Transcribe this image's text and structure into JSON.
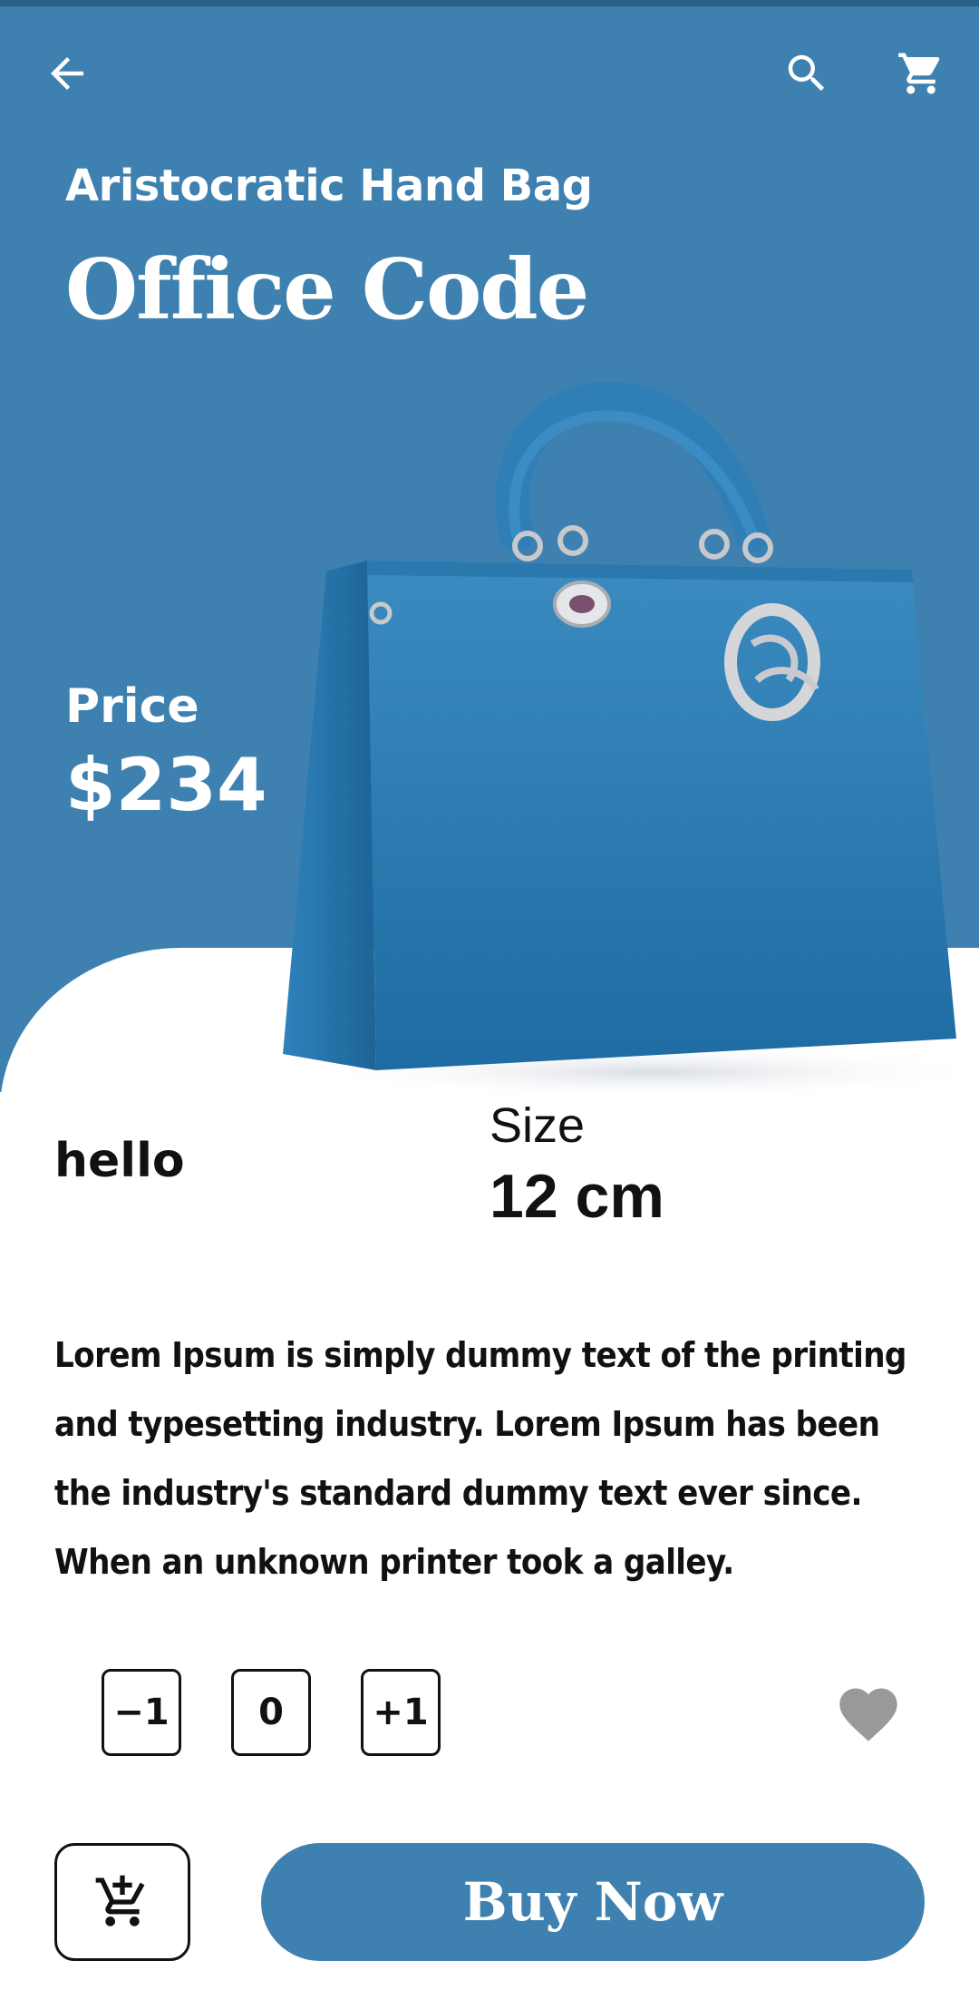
{
  "colors": {
    "accent": "#3e81b0",
    "heart": "#999999"
  },
  "header": {
    "back_icon": "arrow-left-icon",
    "search_icon": "search-icon",
    "cart_icon": "cart-icon"
  },
  "product": {
    "subtitle": "Aristocratic Hand Bag",
    "title": "Office Code",
    "price_label": "Price",
    "price": "$234",
    "color_text": "hello",
    "size_label": "Size",
    "size_value": "12 cm",
    "description": "Lorem Ipsum is simply dummy text of the printing and typesetting industry. Lorem Ipsum has been the industry's standard dummy text ever since. When an unknown printer took a galley."
  },
  "quantity": {
    "decrement_label": "−1",
    "value": "0",
    "increment_label": "+1"
  },
  "actions": {
    "add_to_cart_icon": "cart-plus-icon",
    "buy_label": "Buy Now",
    "favorite_icon": "heart-icon"
  }
}
